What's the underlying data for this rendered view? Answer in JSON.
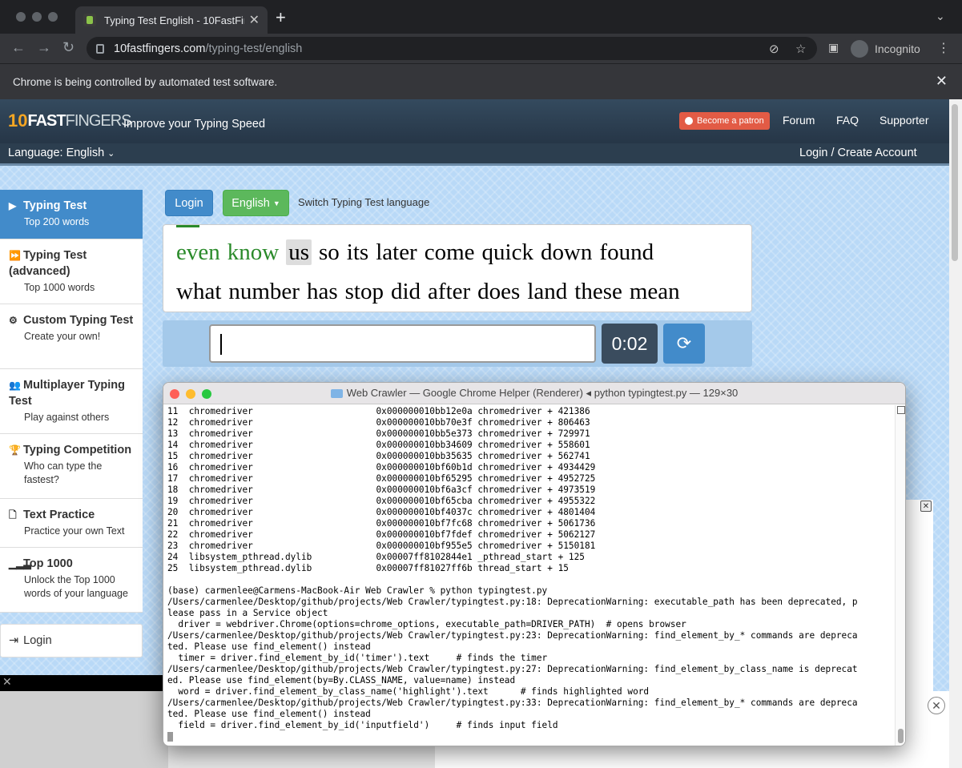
{
  "browser": {
    "tab_title": "Typing Test English - 10FastFin",
    "url_domain": "10fastfingers.com",
    "url_path": "/typing-test/english",
    "incognito_label": "Incognito",
    "infobar": "Chrome is being controlled by automated test software."
  },
  "site": {
    "logo_ten": "10",
    "logo_fast": "FAST",
    "logo_fingers": "FINGERS",
    "tagline": "Improve your Typing Speed",
    "patron": "Become a patron",
    "nav": [
      "Forum",
      "FAQ",
      "Supporter"
    ],
    "language": "Language: English",
    "login_create": "Login / Create Account"
  },
  "sidebar": {
    "items": [
      {
        "title": "Typing Test",
        "sub": "Top 200 words",
        "icon": "play-icon"
      },
      {
        "title": "Typing Test (advanced)",
        "sub": "Top 1000 words",
        "icon": "fast-forward-icon"
      },
      {
        "title": "Custom Typing Test",
        "sub": "Create your own!",
        "icon": "gears-icon"
      },
      {
        "title": "Multiplayer Typing Test",
        "sub": "Play against others",
        "icon": "users-icon"
      },
      {
        "title": "Typing Competition",
        "sub": "Who can type the fastest?",
        "icon": "trophy-icon"
      },
      {
        "title": "Text Practice",
        "sub": "Practice your own Text",
        "icon": "document-icon"
      },
      {
        "title": "Top 1000",
        "sub": "Unlock the Top 1000 words of your language",
        "icon": "signal-icon"
      }
    ],
    "login": "Login"
  },
  "main": {
    "login_btn": "Login",
    "lang_btn": "English",
    "switch_text": "Switch Typing Test language",
    "words_line1": {
      "done": [
        "even",
        "know"
      ],
      "current": "us",
      "rest": [
        "so",
        "its",
        "later",
        "come",
        "quick",
        "down",
        "found"
      ]
    },
    "words_line2": [
      "what",
      "number",
      "has",
      "stop",
      "did",
      "after",
      "does",
      "land",
      "these",
      "mean"
    ],
    "timer": "0:02"
  },
  "terminal": {
    "title": "Web Crawler — Google Chrome Helper (Renderer) ◂ python typingtest.py — 129×30",
    "lines": [
      "11  chromedriver                       0x000000010bb12e0a chromedriver + 421386",
      "12  chromedriver                       0x000000010bb70e3f chromedriver + 806463",
      "13  chromedriver                       0x000000010bb5e373 chromedriver + 729971",
      "14  chromedriver                       0x000000010bb34609 chromedriver + 558601",
      "15  chromedriver                       0x000000010bb35635 chromedriver + 562741",
      "16  chromedriver                       0x000000010bf60b1d chromedriver + 4934429",
      "17  chromedriver                       0x000000010bf65295 chromedriver + 4952725",
      "18  chromedriver                       0x000000010bf6a3cf chromedriver + 4973519",
      "19  chromedriver                       0x000000010bf65cba chromedriver + 4955322",
      "20  chromedriver                       0x000000010bf4037c chromedriver + 4801404",
      "21  chromedriver                       0x000000010bf7fc68 chromedriver + 5061736",
      "22  chromedriver                       0x000000010bf7fdef chromedriver + 5062127",
      "23  chromedriver                       0x000000010bf955e5 chromedriver + 5150181",
      "24  libsystem_pthread.dylib            0x00007ff8102844e1 _pthread_start + 125",
      "25  libsystem_pthread.dylib            0x00007ff81027ff6b thread_start + 15",
      "",
      "(base) carmenlee@Carmens-MacBook-Air Web Crawler % python typingtest.py",
      "/Users/carmenlee/Desktop/github/projects/Web Crawler/typingtest.py:18: DeprecationWarning: executable_path has been deprecated, p",
      "lease pass in a Service object",
      "  driver = webdriver.Chrome(options=chrome_options, executable_path=DRIVER_PATH)  # opens browser",
      "/Users/carmenlee/Desktop/github/projects/Web Crawler/typingtest.py:23: DeprecationWarning: find_element_by_* commands are depreca",
      "ted. Please use find_element() instead",
      "  timer = driver.find_element_by_id('timer').text     # finds the timer",
      "/Users/carmenlee/Desktop/github/projects/Web Crawler/typingtest.py:27: DeprecationWarning: find_element_by_class_name is deprecat",
      "ed. Please use find_element(by=By.CLASS_NAME, value=name) instead",
      "  word = driver.find_element_by_class_name('highlight').text      # finds highlighted word",
      "/Users/carmenlee/Desktop/github/projects/Web Crawler/typingtest.py:33: DeprecationWarning: find_element_by_* commands are depreca",
      "ted. Please use find_element() instead",
      "  field = driver.find_element_by_id('inputfield')     # finds input field"
    ]
  },
  "colors": {
    "accent": "#428bca",
    "success": "#5cb85c",
    "header": "#2c3e4f",
    "patron": "#e25b45"
  }
}
